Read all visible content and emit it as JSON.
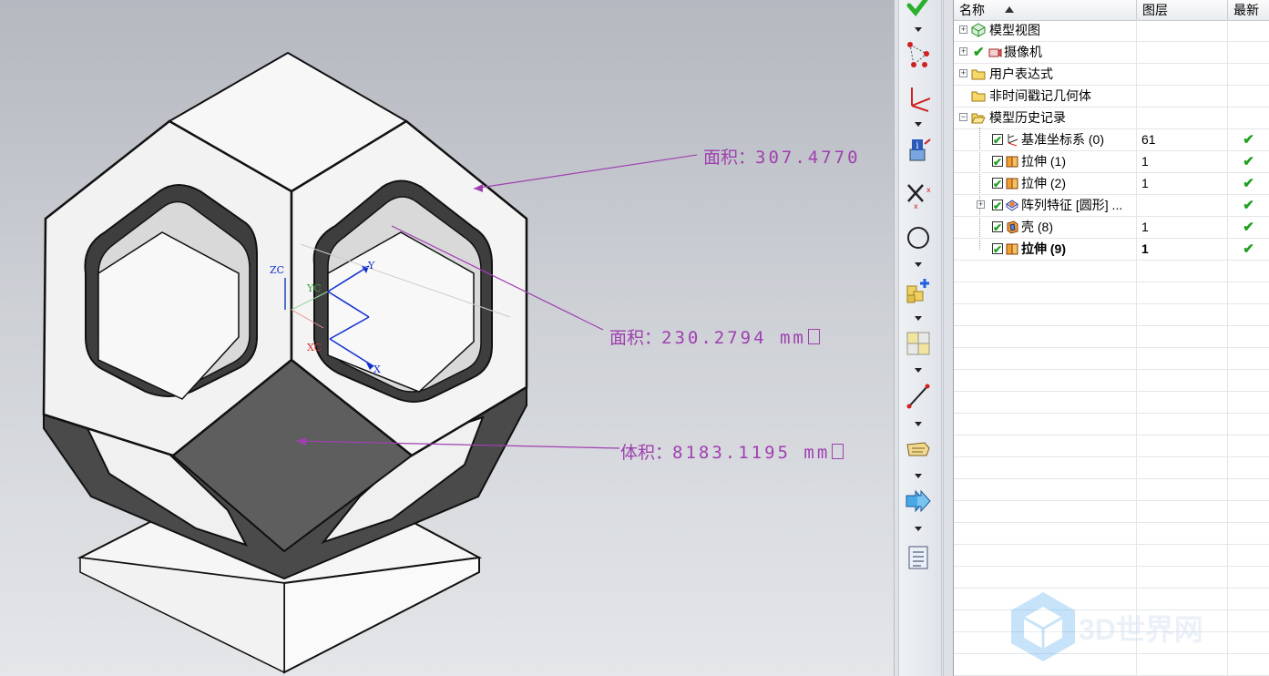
{
  "viewport": {
    "annotations": {
      "area1": {
        "label": "面积：",
        "value": "307.4770"
      },
      "area2": {
        "label": "面积：",
        "value": "230.2794 mm"
      },
      "volume": {
        "label": "体积：",
        "value": "8183.1195 mm"
      }
    },
    "axes": {
      "zc": "ZC",
      "yc": "YC",
      "xc": "XC",
      "x": "X",
      "y": "Y"
    }
  },
  "toolbar": {
    "icons": [
      "green-check-icon",
      "point-set-icon",
      "datum-csys-icon",
      "info-icon",
      "delete-icon",
      "circle-icon",
      "add-component-icon",
      "assembly-icon",
      "line-icon",
      "annotation-icon",
      "arrow-forward-icon",
      "list-icon"
    ]
  },
  "navigator": {
    "columns": {
      "name": "名称",
      "layer": "图层",
      "latest": "最新"
    },
    "rows": [
      {
        "name": "模型视图",
        "layer": "",
        "latest": "",
        "icon": "model-view-icon"
      },
      {
        "name": "摄像机",
        "layer": "",
        "latest": "",
        "icon": "camera-icon"
      },
      {
        "name": "用户表达式",
        "layer": "",
        "latest": "",
        "icon": "folder-icon"
      },
      {
        "name": "非时间戳记几何体",
        "layer": "",
        "latest": "",
        "icon": "folder-icon"
      },
      {
        "name": "模型历史记录",
        "layer": "",
        "latest": "",
        "icon": "folder-icon"
      },
      {
        "name": "基准坐标系 (0)",
        "layer": "61",
        "latest": "✔",
        "icon": "datum-csys-icon"
      },
      {
        "name": "拉伸 (1)",
        "layer": "1",
        "latest": "✔",
        "icon": "extrude-icon"
      },
      {
        "name": "拉伸 (2)",
        "layer": "1",
        "latest": "✔",
        "icon": "extrude-icon"
      },
      {
        "name": "阵列特征 [圆形] ...",
        "layer": "",
        "latest": "✔",
        "icon": "pattern-icon"
      },
      {
        "name": "壳 (8)",
        "layer": "1",
        "latest": "✔",
        "icon": "shell-icon"
      },
      {
        "name": "拉伸 (9)",
        "layer": "1",
        "latest": "✔",
        "icon": "extrude-icon"
      }
    ]
  },
  "watermark": {
    "text": "3D世界网"
  }
}
